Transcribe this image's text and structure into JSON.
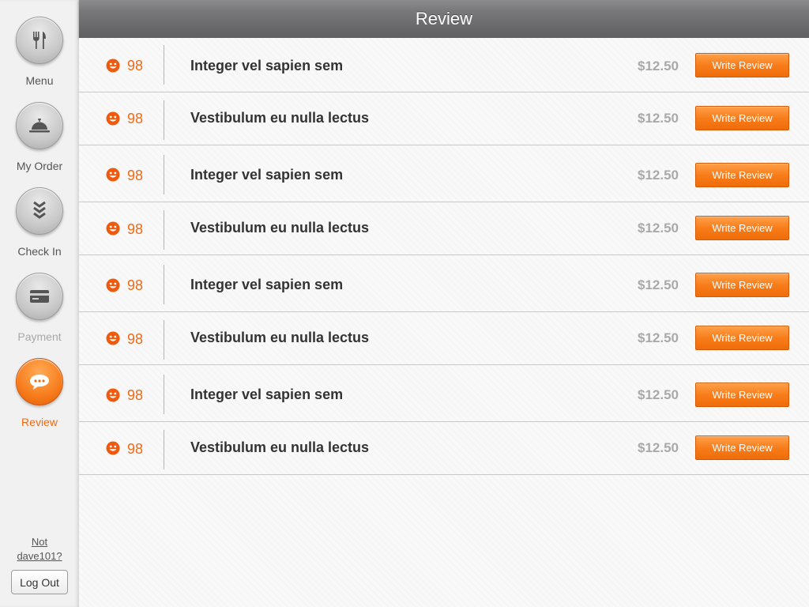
{
  "header": {
    "title": "Review"
  },
  "sidebar": {
    "items": [
      {
        "label": "Menu",
        "icon": "fork-knife-icon",
        "state": "normal"
      },
      {
        "label": "My Order",
        "icon": "service-bell-icon",
        "state": "normal"
      },
      {
        "label": "Check In",
        "icon": "chevrons-down-icon",
        "state": "normal"
      },
      {
        "label": "Payment",
        "icon": "credit-card-icon",
        "state": "disabled"
      },
      {
        "label": "Review",
        "icon": "chat-bubble-icon",
        "state": "active"
      }
    ],
    "not_user_line1": "Not",
    "not_user_line2": "dave101?",
    "logout_label": "Log Out"
  },
  "reviews": [
    {
      "score": "98",
      "name": "Integer vel sapien sem",
      "price": "$12.50",
      "button": "Write Review"
    },
    {
      "score": "98",
      "name": "Vestibulum eu nulla lectus",
      "price": "$12.50",
      "button": "Write Review"
    },
    {
      "score": "98",
      "name": "Integer vel sapien sem",
      "price": "$12.50",
      "button": "Write Review"
    },
    {
      "score": "98",
      "name": "Vestibulum eu nulla lectus",
      "price": "$12.50",
      "button": "Write Review"
    },
    {
      "score": "98",
      "name": "Integer vel sapien sem",
      "price": "$12.50",
      "button": "Write Review"
    },
    {
      "score": "98",
      "name": "Vestibulum eu nulla lectus",
      "price": "$12.50",
      "button": "Write Review"
    },
    {
      "score": "98",
      "name": "Integer vel sapien sem",
      "price": "$12.50",
      "button": "Write Review"
    },
    {
      "score": "98",
      "name": "Vestibulum eu nulla lectus",
      "price": "$12.50",
      "button": "Write Review"
    }
  ],
  "colors": {
    "accent": "#f26a12",
    "header_bg": "#707072",
    "price": "#a9a9a9"
  }
}
